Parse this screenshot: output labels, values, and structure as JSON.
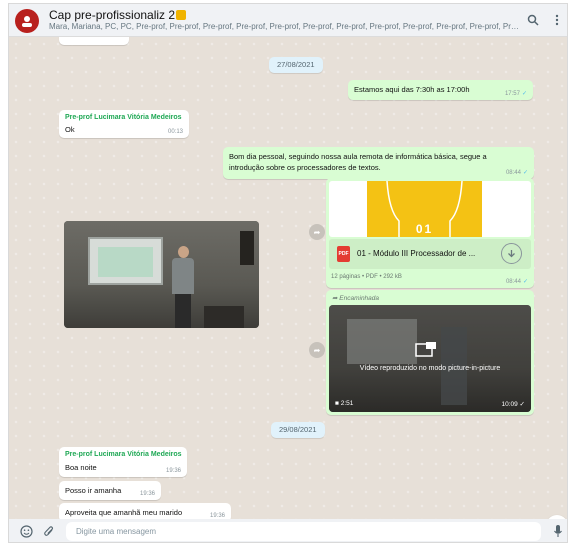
{
  "header": {
    "title": "Cap pre-profissionaliz 2",
    "subtitle": "Mara, Mariana, PC, PC, Pre-prof, Pre-prof, Pre-prof, Pre-prof, Pre-prof, Pre-prof, Pre-prof, Pre-prof, Pre-prof, Pre-prof, Pre-prof, Pre-prof, Pre-prof, Pre-prof,..."
  },
  "dates": {
    "first": "27/08/2021",
    "second": "29/08/2021"
  },
  "messages": {
    "m1": {
      "text": "Estamos aqui das 7:30h as 17:00h",
      "time": "17:57"
    },
    "m2": {
      "sender": "Pre-prof Lucimara Vitória Medeiros",
      "text": "Ok",
      "time": "00:13"
    },
    "m3": {
      "line1": "Bom dia pessoal, seguindo nossa aula remota de informática básica, segue a",
      "line2": "introdução sobre os processadores de textos.",
      "time": "08:44"
    },
    "doc": {
      "thumb_text": "01",
      "file_badge": "PDF",
      "file_name": "01 - Módulo III Processador de ...",
      "meta": "12 páginas • PDF • 292 kB",
      "time": "08:44"
    },
    "video": {
      "forwarded": "Encaminhada",
      "pip_text": "Vídeo reproduzido no modo picture-in-picture",
      "duration": "2:51",
      "time": "10:09"
    },
    "m4": {
      "sender": "Pre-prof Lucimara Vitória Medeiros",
      "text": "Boa noite",
      "time": "19:36"
    },
    "m5": {
      "text": "Posso ir amanha",
      "time": "19:36"
    },
    "m6": {
      "text": "Aproveita que amanhã meu marido",
      "time": "19:36"
    }
  },
  "composer": {
    "placeholder": "Digite uma mensagem"
  },
  "colors": {
    "outgoing": "#d9fdd3",
    "incoming": "#ffffff",
    "sender_name": "#1fa855",
    "read_tick": "#53bdeb"
  },
  "icons": [
    "group-avatar",
    "search-icon",
    "menu-icon",
    "forward-icon",
    "download-icon",
    "pdf-icon",
    "pip-icon",
    "video-camera-icon",
    "emoji-icon",
    "attach-icon",
    "mic-icon",
    "chevron-down-icon"
  ]
}
